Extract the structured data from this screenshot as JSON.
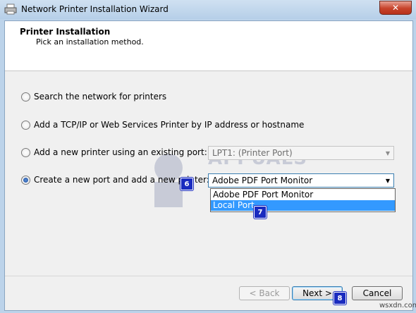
{
  "window": {
    "title": "Network Printer Installation Wizard",
    "close_glyph": "✕"
  },
  "header": {
    "title": "Printer Installation",
    "subtitle": "Pick an installation method."
  },
  "options": [
    {
      "label": "Search the network for printers",
      "selected": false
    },
    {
      "label": "Add a TCP/IP or Web Services Printer by IP address or hostname",
      "selected": false
    },
    {
      "label": "Add a new printer using an existing port:",
      "selected": false
    },
    {
      "label": "Create a new port and add a new printer:",
      "selected": true
    }
  ],
  "existing_port_combo": {
    "value": "LPT1: (Printer Port)",
    "disabled": true
  },
  "new_port_combo": {
    "value": "Adobe PDF Port Monitor"
  },
  "dropdown": {
    "items": [
      "Adobe PDF Port Monitor",
      "Local Port"
    ],
    "highlighted": "Local Port"
  },
  "badges": {
    "b6": "6",
    "b7": "7",
    "b8": "8"
  },
  "buttons": {
    "back": "< Back",
    "next": "Next >",
    "cancel": "Cancel"
  },
  "watermark": {
    "text": "APPUALS"
  },
  "site": "wsxdn.com",
  "colors": {
    "selection": "#3399ff",
    "badge": "#1a2bbf",
    "close": "#c7432b"
  }
}
